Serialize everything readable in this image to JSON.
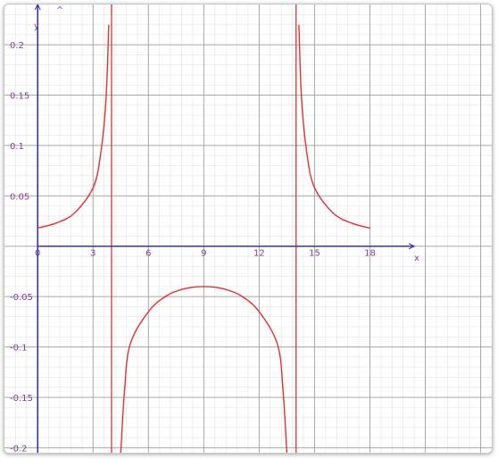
{
  "chart_data": {
    "type": "line",
    "xlabel": "x",
    "ylabel": "y",
    "xlim": [
      -1.8,
      24.6
    ],
    "ylim": [
      -0.205,
      0.24
    ],
    "x_ticks": [
      0,
      3,
      6,
      9,
      12,
      15,
      18
    ],
    "x_tick_labels": [
      "0",
      "3",
      "6",
      "9",
      "12",
      "15",
      "18"
    ],
    "y_ticks": [
      0.2,
      0.15,
      0.1,
      0.05,
      -0.05,
      -0.1,
      -0.15,
      -0.2
    ],
    "y_tick_labels": [
      "0.2",
      "0.15",
      "0.1",
      "0.05",
      "-0.05",
      "-0.1",
      "-0.15",
      "-0.2"
    ],
    "grid": true,
    "colors": {
      "curve": "#e83030",
      "axis": "#3232c8",
      "tick_text": "#8a3a9c",
      "grid_major": "#a8a8a8",
      "grid_minor": "#e4e4e4"
    },
    "asymptotes": [
      4,
      14
    ],
    "series": [
      {
        "points": [
          [
            0,
            0.018
          ],
          [
            1,
            0.023
          ],
          [
            2,
            0.033
          ],
          [
            3,
            0.058
          ],
          [
            3.4,
            0.09
          ],
          [
            3.7,
            0.145
          ],
          [
            3.85,
            0.22
          ]
        ]
      },
      {
        "points": [
          [
            4.5,
            -0.205
          ],
          [
            4.7,
            -0.145
          ],
          [
            5,
            -0.098
          ],
          [
            6,
            -0.065
          ],
          [
            7,
            -0.049
          ],
          [
            8,
            -0.042
          ],
          [
            9,
            -0.04
          ],
          [
            10,
            -0.042
          ],
          [
            11,
            -0.049
          ],
          [
            12,
            -0.065
          ],
          [
            13,
            -0.098
          ],
          [
            13.3,
            -0.145
          ],
          [
            13.5,
            -0.205
          ]
        ]
      },
      {
        "points": [
          [
            14.15,
            0.22
          ],
          [
            14.3,
            0.145
          ],
          [
            14.6,
            0.09
          ],
          [
            15,
            0.058
          ],
          [
            16,
            0.033
          ],
          [
            17,
            0.023
          ],
          [
            18,
            0.018
          ]
        ]
      }
    ],
    "markers": [
      {
        "label": "^",
        "x": 1.2,
        "y": 0.235
      }
    ]
  }
}
